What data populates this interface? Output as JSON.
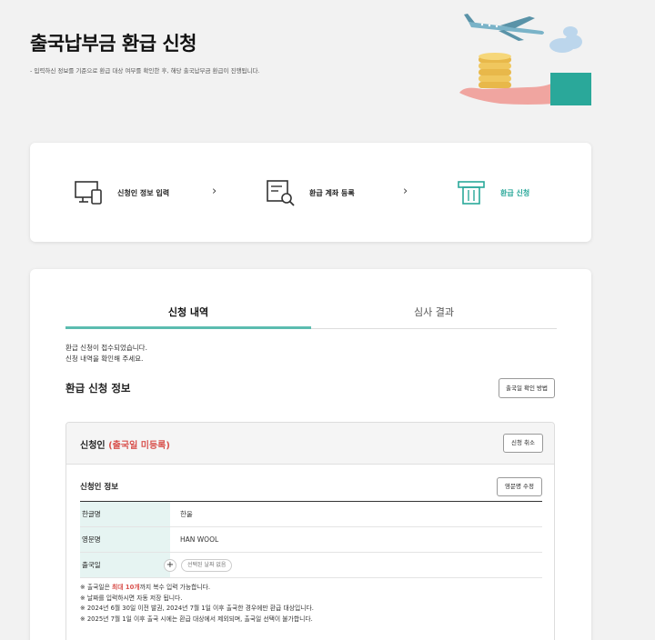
{
  "page": {
    "title": "출국납부금 환급 신청",
    "description": "- 입력하신 정보를 기준으로 환급 대상 여부를 확인한 후, 해당 출국납부금 환급이 진행됩니다."
  },
  "steps": [
    {
      "label": "신청인 정보 입력",
      "icon": "computer-devices-icon"
    },
    {
      "label": "환급 계좌 등록",
      "icon": "document-search-icon"
    },
    {
      "label": "환급 신청",
      "icon": "atm-icon"
    }
  ],
  "step_arrow": "›",
  "colors": {
    "accent": "#2aa89a",
    "tab_underline": "#5bbcb0",
    "alert": "#d9534f",
    "table_header_bg": "#e6f4f2"
  },
  "tabs": [
    {
      "label": "신청 내역",
      "active": true
    },
    {
      "label": "심사 결과",
      "active": false
    }
  ],
  "notice": {
    "line1": "환급 신청이 접수되었습니다.",
    "line2": "신청 내역을 확인해 주세요."
  },
  "section": {
    "title": "환급 신청 정보",
    "check_button": "출국일 확인 방법"
  },
  "applicant": {
    "label": "신청인",
    "status": "(출국일 미등록)",
    "cancel_button": "신청 취소",
    "info_title": "신청인 정보",
    "edit_button": "영문명 수정",
    "rows": {
      "korean_name_label": "한글명",
      "korean_name_value": "한울",
      "english_name_label": "영문명",
      "english_name_value": "HAN WOOL",
      "departure_label": "출국일",
      "departure_value": "선택된 날짜 없음",
      "add_symbol": "+"
    }
  },
  "notes": {
    "n1_prefix": "※ 출국일은 ",
    "n1_highlight": "최대 10개",
    "n1_suffix": "까지 복수 입력 가능합니다.",
    "n2": "※ 날짜를 입력하시면 자동 저장 됩니다.",
    "n3": "※ 2024년 6월 30일 이전 발권, 2024년 7월 1일 이후 출국한 경우에만 환급 대상입니다.",
    "n4": "※ 2025년 7월 1일 이후 출국 시에는 환급 대상에서 제외되며, 출국일 선택이 불가합니다."
  }
}
